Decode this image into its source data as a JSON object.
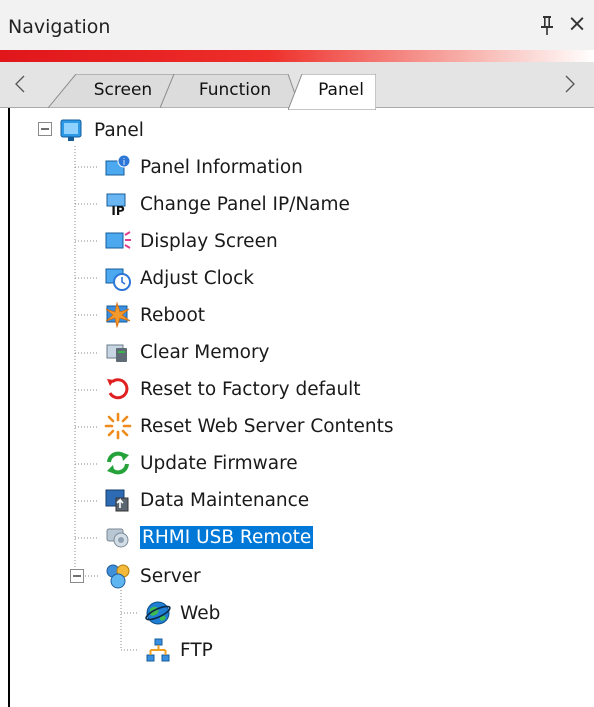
{
  "window": {
    "title": "Navigation",
    "pin_icon": "pin-icon",
    "close_symbol": "×"
  },
  "tabs": [
    {
      "label": "Screen",
      "active": false
    },
    {
      "label": "Function",
      "active": false
    },
    {
      "label": "Panel",
      "active": true
    }
  ],
  "tree": {
    "root": {
      "label": "Panel",
      "expanded": true,
      "icon": "monitor-icon"
    },
    "items": [
      {
        "label": "Panel Information",
        "icon": "panel-info-icon"
      },
      {
        "label": "Change Panel IP/Name",
        "icon": "ip-icon"
      },
      {
        "label": "Display Screen",
        "icon": "display-screen-icon"
      },
      {
        "label": "Adjust Clock",
        "icon": "clock-icon"
      },
      {
        "label": "Reboot",
        "icon": "reboot-icon"
      },
      {
        "label": "Clear Memory",
        "icon": "clear-memory-icon"
      },
      {
        "label": "Reset to Factory default",
        "icon": "reset-icon"
      },
      {
        "label": "Reset Web Server Contents",
        "icon": "burst-icon"
      },
      {
        "label": "Update Firmware",
        "icon": "refresh-icon"
      },
      {
        "label": "Data Maintenance",
        "icon": "data-maintenance-icon"
      },
      {
        "label": "RHMI USB Remote",
        "icon": "usb-remote-icon",
        "selected": true
      }
    ],
    "server": {
      "label": "Server",
      "expanded": true,
      "icon": "server-icon",
      "children": [
        {
          "label": "Web",
          "icon": "globe-icon"
        },
        {
          "label": "FTP",
          "icon": "network-icon"
        }
      ]
    }
  },
  "colors": {
    "accent_red": "#e0161b",
    "selection": "#0078d7",
    "tab_strip": "#e4e4e4"
  }
}
